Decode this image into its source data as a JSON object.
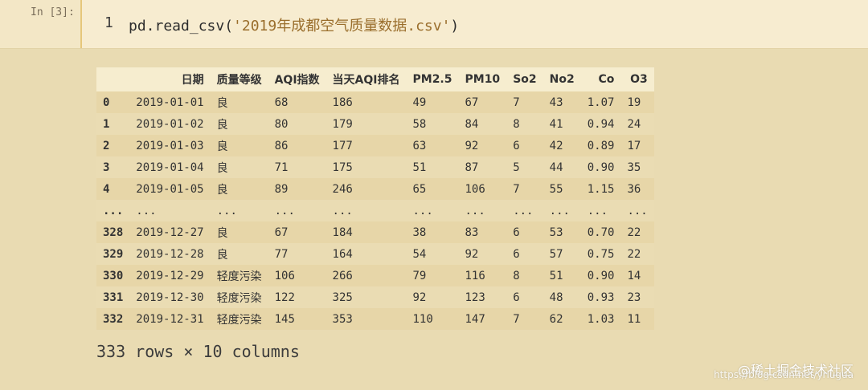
{
  "cell": {
    "prompt": "In [3]:",
    "line_number": "1",
    "code_prefix": "pd.read_csv(",
    "code_string": "'2019年成都空气质量数据.csv'",
    "code_suffix": ")"
  },
  "table": {
    "columns": [
      "",
      "日期",
      "质量等级",
      "AQI指数",
      "当天AQI排名",
      "PM2.5",
      "PM10",
      "So2",
      "No2",
      "Co",
      "O3"
    ],
    "rows": [
      [
        "0",
        "2019-01-01",
        "良",
        "68",
        "186",
        "49",
        "67",
        "7",
        "43",
        "1.07",
        "19"
      ],
      [
        "1",
        "2019-01-02",
        "良",
        "80",
        "179",
        "58",
        "84",
        "8",
        "41",
        "0.94",
        "24"
      ],
      [
        "2",
        "2019-01-03",
        "良",
        "86",
        "177",
        "63",
        "92",
        "6",
        "42",
        "0.89",
        "17"
      ],
      [
        "3",
        "2019-01-04",
        "良",
        "71",
        "175",
        "51",
        "87",
        "5",
        "44",
        "0.90",
        "35"
      ],
      [
        "4",
        "2019-01-05",
        "良",
        "89",
        "246",
        "65",
        "106",
        "7",
        "55",
        "1.15",
        "36"
      ],
      [
        "...",
        "...",
        "...",
        "...",
        "...",
        "...",
        "...",
        "...",
        "...",
        "...",
        "..."
      ],
      [
        "328",
        "2019-12-27",
        "良",
        "67",
        "184",
        "38",
        "83",
        "6",
        "53",
        "0.70",
        "22"
      ],
      [
        "329",
        "2019-12-28",
        "良",
        "77",
        "164",
        "54",
        "92",
        "6",
        "57",
        "0.75",
        "22"
      ],
      [
        "330",
        "2019-12-29",
        "轻度污染",
        "106",
        "266",
        "79",
        "116",
        "8",
        "51",
        "0.90",
        "14"
      ],
      [
        "331",
        "2019-12-30",
        "轻度污染",
        "122",
        "325",
        "92",
        "123",
        "6",
        "48",
        "0.93",
        "23"
      ],
      [
        "332",
        "2019-12-31",
        "轻度污染",
        "145",
        "353",
        "110",
        "147",
        "7",
        "62",
        "1.03",
        "11"
      ]
    ]
  },
  "summary": "333 rows × 10 columns",
  "watermark": {
    "main": "@稀土掘金技术社区",
    "sub": "https://blog.csdn.net/yrlugua"
  }
}
